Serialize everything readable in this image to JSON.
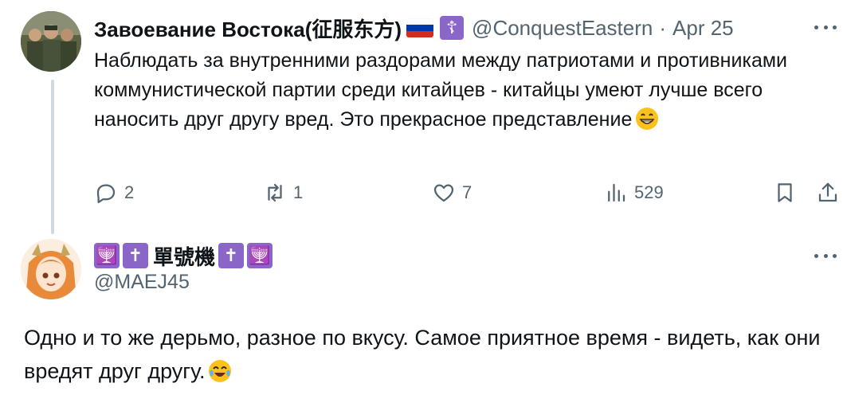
{
  "tweet1": {
    "display_name": "Завоевание Востока(征服东方)",
    "handle": "@ConquestEastern",
    "separator": "·",
    "date": "Apr 25",
    "text": "Наблюдать за внутренними раздорами между патриотами и противниками коммунистической партии среди китайцев - китайцы умеют лучше всего наносить друг другу вред. Это прекрасное представление",
    "cross_badge": "☦",
    "stats": {
      "replies": "2",
      "reposts": "1",
      "likes": "7",
      "views": "529"
    }
  },
  "tweet2": {
    "badge_left_1": "🕎",
    "badge_left_2": "✝",
    "display_name": "單號機",
    "badge_right_1": "✝",
    "badge_right_2": "🕎",
    "handle": "@MAEJ45",
    "text": "Одно и то же дерьмо, разное по вкусу. Самое приятное время - видеть, как они вредят друг другу."
  },
  "colors": {
    "text": "#0f1419",
    "secondary": "#536471",
    "thread_line": "#cfd9de",
    "badge_purple": "#8b66c9"
  },
  "icons": [
    "reply-icon",
    "repost-icon",
    "like-icon",
    "views-icon",
    "bookmark-icon",
    "share-icon",
    "more-icon",
    "grin-emoji",
    "tears-of-joy-emoji"
  ]
}
